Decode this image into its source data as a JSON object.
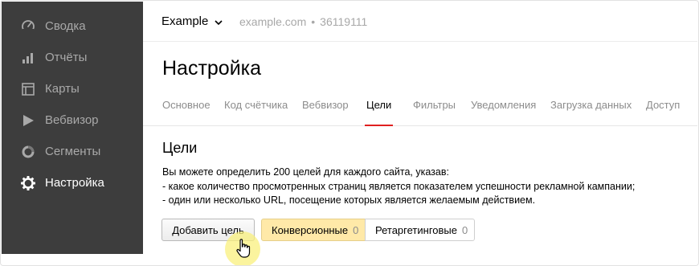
{
  "sidebar": {
    "items": [
      {
        "label": "Сводка",
        "icon": "gauge-icon"
      },
      {
        "label": "Отчёты",
        "icon": "bar-chart-icon"
      },
      {
        "label": "Карты",
        "icon": "map-layout-icon"
      },
      {
        "label": "Вебвизор",
        "icon": "play-icon"
      },
      {
        "label": "Сегменты",
        "icon": "segments-ring-icon"
      },
      {
        "label": "Настройка",
        "icon": "gear-icon",
        "active": true
      }
    ]
  },
  "header": {
    "site_name": "Example",
    "domain": "example.com",
    "separator": "•",
    "counter_id": "36119111"
  },
  "page": {
    "title": "Настройка"
  },
  "tabs": [
    {
      "label": "Основное"
    },
    {
      "label": "Код счётчика"
    },
    {
      "label": "Вебвизор"
    },
    {
      "label": "Цели",
      "active": true
    },
    {
      "label": "Фильтры"
    },
    {
      "label": "Уведомления"
    },
    {
      "label": "Загрузка данных"
    },
    {
      "label": "Доступ"
    }
  ],
  "goals": {
    "title": "Цели",
    "description": [
      "Вы можете определить 200 целей для каждого сайта, указав:",
      "- какое количество просмотренных страниц является показателем успешности рекламной кампании;",
      "- один или несколько URL, посещение которых является желаемым действием."
    ],
    "add_button": "Добавить цель",
    "filters": [
      {
        "label": "Конверсионные",
        "count": "0",
        "selected": true
      },
      {
        "label": "Ретаргетинговые",
        "count": "0",
        "selected": false
      }
    ]
  },
  "colors": {
    "sidebar_bg": "#3d3d3d",
    "active_tab_underline": "#e02020",
    "selected_segment_bg": "#ffe9a8"
  }
}
